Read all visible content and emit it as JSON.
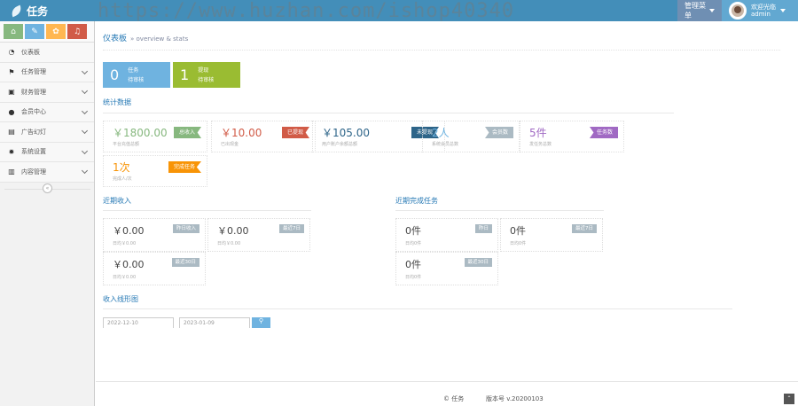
{
  "app": {
    "name": "任务"
  },
  "navbar": {
    "admin_menu": "管理菜单",
    "welcome": "欢迎光临",
    "username": "admin"
  },
  "shortcuts": [
    {
      "icon": "home-icon",
      "glyph": "⌂"
    },
    {
      "icon": "pencil-icon",
      "glyph": "✎"
    },
    {
      "icon": "users-icon",
      "glyph": "✿"
    },
    {
      "icon": "bell-icon",
      "glyph": "♫"
    }
  ],
  "sidebar": {
    "items": [
      {
        "label": "仪表板",
        "icon": "dashboard-icon",
        "glyph": "◔",
        "has_arrow": false
      },
      {
        "label": "任务管理",
        "icon": "flag-icon",
        "glyph": "⚑",
        "has_arrow": true
      },
      {
        "label": "财务管理",
        "icon": "money-icon",
        "glyph": "▣",
        "has_arrow": true
      },
      {
        "label": "会员中心",
        "icon": "user-icon",
        "glyph": "●",
        "has_arrow": true
      },
      {
        "label": "广告幻灯",
        "icon": "picture-icon",
        "glyph": "▤",
        "has_arrow": true
      },
      {
        "label": "系统设置",
        "icon": "gear-icon",
        "glyph": "✹",
        "has_arrow": true
      },
      {
        "label": "内容管理",
        "icon": "inbox-icon",
        "glyph": "▥",
        "has_arrow": true
      }
    ],
    "collapse": "«"
  },
  "header": {
    "title": "仪表板",
    "subtitle": "» overview & stats"
  },
  "watermark": "https://www.huzhan.com/ishop40340",
  "big_boxes": [
    {
      "num": "0",
      "line1": "任务",
      "line2": "待审核"
    },
    {
      "num": "1",
      "line1": "提现",
      "line2": "待审核"
    }
  ],
  "stats_title": "统计数据",
  "stats": [
    {
      "value": "￥1800.00",
      "sub": "平台充值总额",
      "tag": "总收入",
      "color": "#87b87f",
      "tag_color": "#87b87f"
    },
    {
      "value": "￥10.00",
      "sub": "已出现金",
      "tag": "已提现",
      "color": "#d15b47",
      "tag_color": "#d15b47"
    },
    {
      "value": "￥105.00",
      "sub": "用户账户余额总额",
      "tag": "未提现",
      "color": "#2e6589",
      "tag_color": "#2e6589"
    },
    {
      "value": "2人",
      "sub": "系统会员总数",
      "tag": "会员数",
      "color": "#6fb3e0",
      "tag_color": "#abbac3"
    },
    {
      "value": "5件",
      "sub": "发任务总数",
      "tag": "任务数",
      "color": "#a069c3",
      "tag_color": "#a069c3"
    },
    {
      "value": "1次",
      "sub": "完成人/次",
      "tag": "完成任务",
      "color": "#f89406",
      "tag_color": "#f89406"
    }
  ],
  "income_title": "近期收入",
  "income": [
    {
      "value": "￥0.00",
      "sub": "日均￥0.00",
      "tag": "昨日收入"
    },
    {
      "value": "￥0.00",
      "sub": "日均￥0.00",
      "tag": "最近7日"
    },
    {
      "value": "￥0.00",
      "sub": "日均￥0.00",
      "tag": "最近30日"
    }
  ],
  "tasks_title": "近期完成任务",
  "tasks": [
    {
      "value": "0件",
      "sub": "日均0件",
      "tag": "昨日"
    },
    {
      "value": "0件",
      "sub": "日均0件",
      "tag": "最近7日"
    },
    {
      "value": "0件",
      "sub": "日均0件",
      "tag": "最近30日"
    }
  ],
  "chart_title": "收入线形图",
  "date_from": "2022-12-10",
  "date_to": "2023-01-09",
  "search_glyph": "⚲",
  "footer": {
    "brand": "© 任务",
    "version": "版本号 v.20200103"
  },
  "to_top": "⌃"
}
